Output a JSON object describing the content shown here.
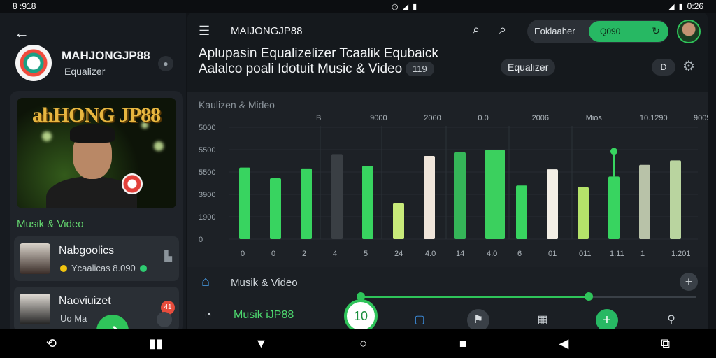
{
  "status_bar": {
    "time_left": "8 :918",
    "time_right": "0:26"
  },
  "left": {
    "brand_title": "MAHJONGJP88",
    "brand_subtitle": "Equalizer",
    "hero_title": "ahHONG JP88",
    "section_label": "Musik & Video",
    "items": [
      {
        "title": "Nabgoolics",
        "meta": "Ycaalicas 8.090"
      },
      {
        "title": "Naoviuizet",
        "meta": "Uo Ma"
      }
    ],
    "badge_count": "41"
  },
  "header": {
    "app_title": "MAIJONGJP88",
    "pill_label": "Eoklaaher",
    "pill_green": "Q090",
    "headline": "Aplupasin Equalizelizer Tcaalik Equbaick Aalalco poali Idotuit Music & Video",
    "headline_count": "119",
    "eq_chip": "Equalizer",
    "chip_d": "D"
  },
  "chart_data": {
    "type": "bar",
    "title": "Kaulizen & Mideo",
    "y_tick_labels": [
      "5000",
      "5500",
      "5500",
      "3900",
      "1900",
      "0"
    ],
    "x_tick_labels": [
      "0",
      "0",
      "2",
      "4",
      "5",
      "24",
      "4.0",
      "14",
      "4.0",
      "6",
      "01",
      "011",
      "1.11",
      "1",
      "1.201"
    ],
    "top_labels": [
      "B",
      "9000",
      "2060",
      "0.0",
      "2006",
      "Mios",
      "10.1290",
      "9009"
    ],
    "values": [
      80,
      68,
      79,
      95,
      82,
      40,
      93,
      97,
      100,
      60,
      78,
      58,
      70,
      83,
      88
    ],
    "colors": [
      "#38d460",
      "#38d460",
      "#38d460",
      "#3a3f44",
      "#38d460",
      "#c8ea7a",
      "#efe5da",
      "#35b558",
      "#3bd05e",
      "#38d460",
      "#f3efe6",
      "#b5e36a",
      "#38d460",
      "#b8c2a8",
      "#b9d49f"
    ],
    "highlight_index": 12,
    "ylim": [
      0,
      100
    ]
  },
  "bottom": {
    "mv_label": "Musik & Video",
    "vol_label": "Musik iJP88",
    "knob_value": "10",
    "slider_fraction": 0.68
  }
}
